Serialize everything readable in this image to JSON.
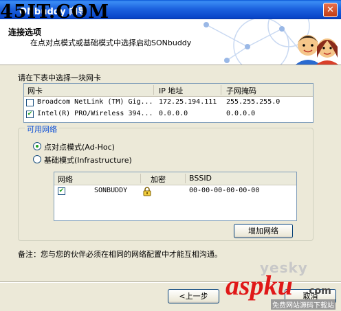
{
  "watermark": "45IT.COM",
  "window": {
    "title": "ONbuddy 向导",
    "close_glyph": "✕"
  },
  "header": {
    "title": "连接选项",
    "subtitle": "在点对点模式或基础模式中选择启动SONbuddy"
  },
  "adapter_prompt": "请在下表中选择一块网卡",
  "adapter_table": {
    "columns": [
      "网卡",
      "IP 地址",
      "子网掩码"
    ],
    "rows": [
      {
        "checked": false,
        "name": "Broadcom NetLink (TM) Gig...",
        "ip": "172.25.194.111",
        "mask": "255.255.255.0"
      },
      {
        "checked": true,
        "name": "Intel(R) PRO/Wireless 394...",
        "ip": "0.0.0.0",
        "mask": "0.0.0.0"
      }
    ]
  },
  "available_networks": {
    "label": "可用网络",
    "modes": [
      {
        "label": "点对点模式(Ad-Hoc)",
        "selected": true
      },
      {
        "label": "基础模式(Infrastructure)",
        "selected": false
      }
    ],
    "table": {
      "columns": [
        "网络",
        "加密",
        "BSSID"
      ],
      "rows": [
        {
          "checked": true,
          "name": "SONBUDDY",
          "icon": "lock-icon",
          "bssid": "00-00-00-00-00-00"
        }
      ]
    },
    "add_button": "增加网络"
  },
  "note": "备注：您与您的伙伴必须在相同的网络配置中才能互相沟通。",
  "buttons": {
    "back": "<上一步",
    "cancel": "取消"
  },
  "logo": {
    "yesky": "yesky",
    "brand": "aspku",
    "tld": ".com",
    "tagline": "免费网站源码下载站"
  },
  "colors": {
    "title_blue": "#0a57d6",
    "group_label": "#0046d5",
    "brand_red": "#e01818",
    "check_green": "#21a121"
  }
}
